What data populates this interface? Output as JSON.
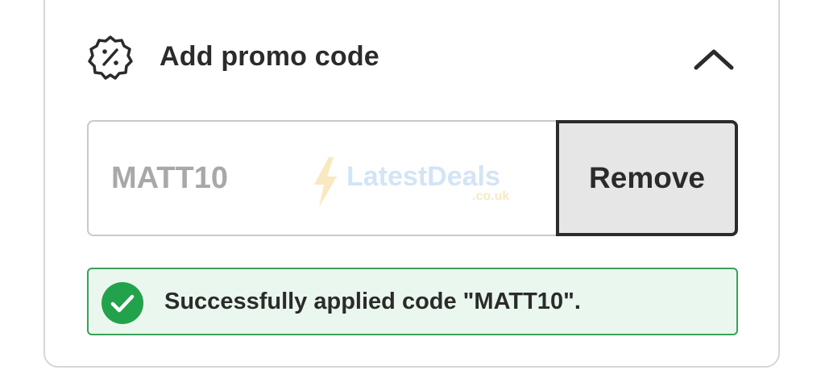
{
  "promo_section": {
    "title": "Add promo code",
    "icon": "discount-badge-icon",
    "collapse_icon": "chevron-up-icon"
  },
  "promo_form": {
    "code_value": "MATT10",
    "remove_label": "Remove"
  },
  "watermark": {
    "brand": "LatestDeals",
    "domain": ".co.uk"
  },
  "status": {
    "message": "Successfully applied code \"MATT10\".",
    "icon": "check-circle-icon",
    "color": "#3aa15a",
    "background": "#eaf7ee"
  }
}
